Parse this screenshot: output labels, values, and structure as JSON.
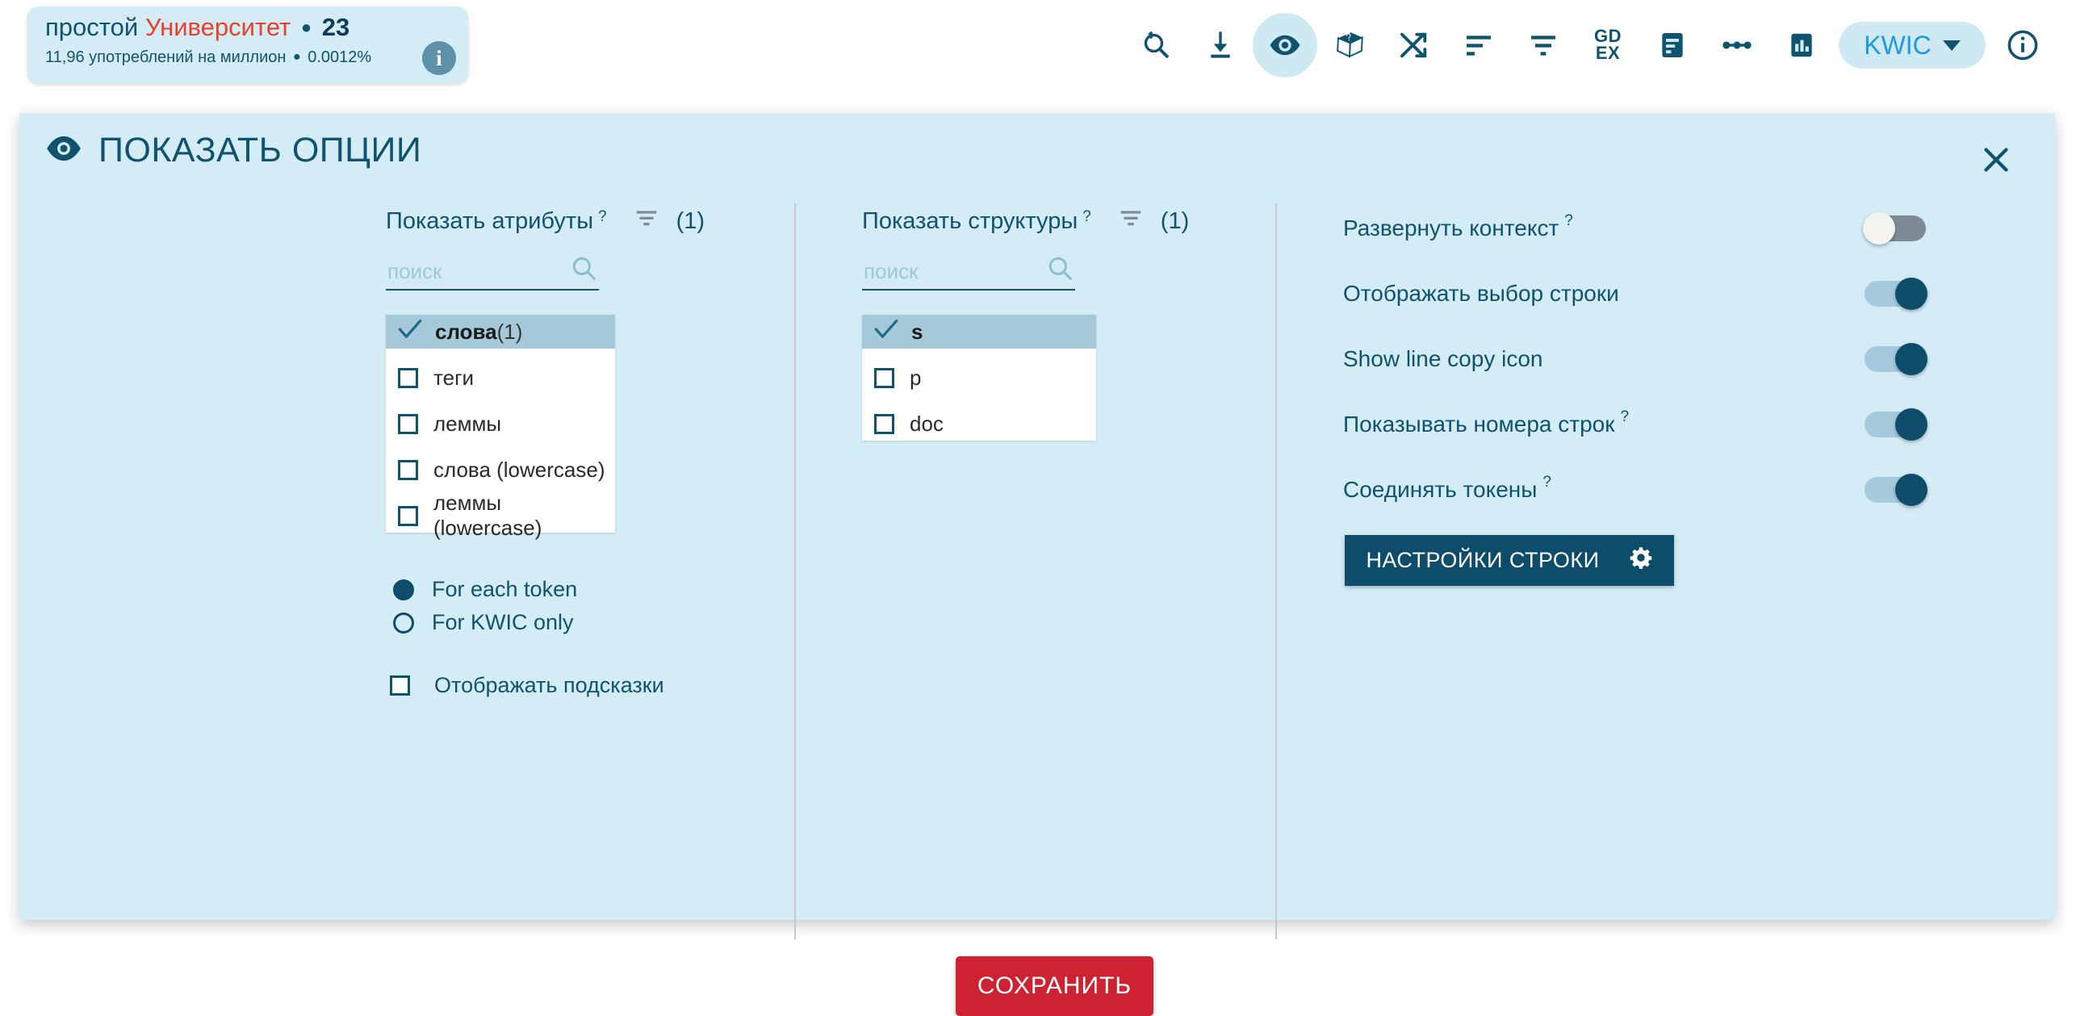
{
  "word_card": {
    "lemma": "простой",
    "word": "Университет",
    "separator": "●",
    "count": "23",
    "frequency": "11,96 употреблений на миллион",
    "percent": "0.0012%",
    "info_icon": "info-icon",
    "info_letter": "i"
  },
  "toolbar": {
    "items": [
      {
        "name": "search-history-icon",
        "label": ""
      },
      {
        "name": "download-icon",
        "label": ""
      },
      {
        "name": "eye-icon",
        "label": "",
        "active": true
      },
      {
        "name": "question-box-icon",
        "label": ""
      },
      {
        "name": "shuffle-icon",
        "label": ""
      },
      {
        "name": "sort-icon",
        "label": ""
      },
      {
        "name": "filter-icon",
        "label": ""
      },
      {
        "name": "gdex-icon",
        "label": "GD\nEX"
      },
      {
        "name": "document-icon",
        "label": ""
      },
      {
        "name": "collocation-icon",
        "label": ""
      },
      {
        "name": "chart-icon",
        "label": ""
      }
    ],
    "gdex_line1": "GD",
    "gdex_line2": "EX",
    "view_mode": "KWIC",
    "help_icon": "info-circle-icon"
  },
  "dialog": {
    "title": "ПОКАЗАТЬ ОПЦИИ",
    "title_icon": "eye-icon",
    "close_icon": "close-icon",
    "save_label": "СОХРАНИТЬ"
  },
  "attributes": {
    "heading": "Показать атрибуты",
    "help_marker": "?",
    "filter_icon": "filter-icon",
    "count": "(1)",
    "search_placeholder": "поиск",
    "search_value": "",
    "search_icon": "search-icon",
    "items": [
      {
        "label": "слова",
        "suffix": " (1)",
        "checked": true
      },
      {
        "label": "теги",
        "suffix": "",
        "checked": false
      },
      {
        "label": "леммы",
        "suffix": "",
        "checked": false
      },
      {
        "label": "слова (lowercase)",
        "suffix": "",
        "checked": false
      },
      {
        "label": "леммы (lowercase)",
        "suffix": "",
        "checked": false
      }
    ],
    "scope_options": [
      {
        "label": "For each token",
        "selected": true
      },
      {
        "label": "For KWIC only",
        "selected": false
      }
    ],
    "tooltips_label": "Отображать подсказки",
    "tooltips_checked": false
  },
  "structures": {
    "heading": "Показать структуры",
    "help_marker": "?",
    "filter_icon": "filter-icon",
    "count": "(1)",
    "search_placeholder": "поиск",
    "search_value": "",
    "search_icon": "search-icon",
    "items": [
      {
        "label": "s",
        "checked": true
      },
      {
        "label": "p",
        "checked": false
      },
      {
        "label": "doc",
        "checked": false
      }
    ]
  },
  "options": {
    "toggles": [
      {
        "label": "Развернуть контекст",
        "help": "?",
        "on": false
      },
      {
        "label": "Отображать выбор строки",
        "help": "",
        "on": true
      },
      {
        "label": "Show line copy icon",
        "help": "",
        "on": true
      },
      {
        "label": "Показывать номера строк",
        "help": "?",
        "on": true
      },
      {
        "label": "Соединять токены",
        "help": "?",
        "on": true
      }
    ],
    "row_settings_label": "НАСТРОЙКИ СТРОКИ",
    "row_settings_icon": "gear-icon"
  },
  "colors": {
    "dialog_bg": "#d3ecf5",
    "accent_dark": "#10536e",
    "selected_row": "#a5c9d9",
    "save_red": "#cc2232",
    "kwic_blue": "#1b9ae0",
    "word_red": "#e8402a"
  }
}
